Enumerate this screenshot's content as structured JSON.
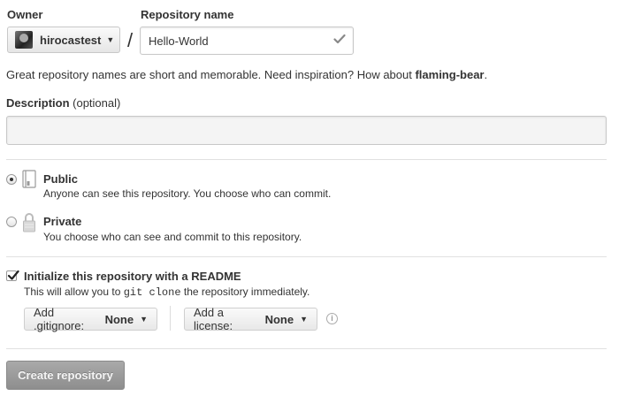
{
  "owner": {
    "label": "Owner",
    "selected": "hirocastest"
  },
  "repo_name": {
    "label": "Repository name",
    "value": "Hello-World"
  },
  "separator": "/",
  "hint": {
    "text": "Great repository names are short and memorable. Need inspiration? How about ",
    "suggestion": "flaming-bear",
    "suffix": "."
  },
  "description": {
    "label": "Description",
    "optional": "(optional)",
    "value": ""
  },
  "visibility": {
    "public": {
      "title": "Public",
      "desc": "Anyone can see this repository. You choose who can commit.",
      "selected": true
    },
    "private": {
      "title": "Private",
      "desc": "You choose who can see and commit to this repository.",
      "selected": false
    }
  },
  "readme": {
    "title": "Initialize this repository with a README",
    "desc_before": "This will allow you to ",
    "desc_code": "git clone",
    "desc_after": " the repository immediately.",
    "checked": true
  },
  "gitignore": {
    "label": "Add .gitignore:",
    "value": "None"
  },
  "license": {
    "label": "Add a license:",
    "value": "None"
  },
  "create_button": "Create repository",
  "colors": {
    "check_green": "#6cc644",
    "button_gray": "#9b9b9b"
  }
}
